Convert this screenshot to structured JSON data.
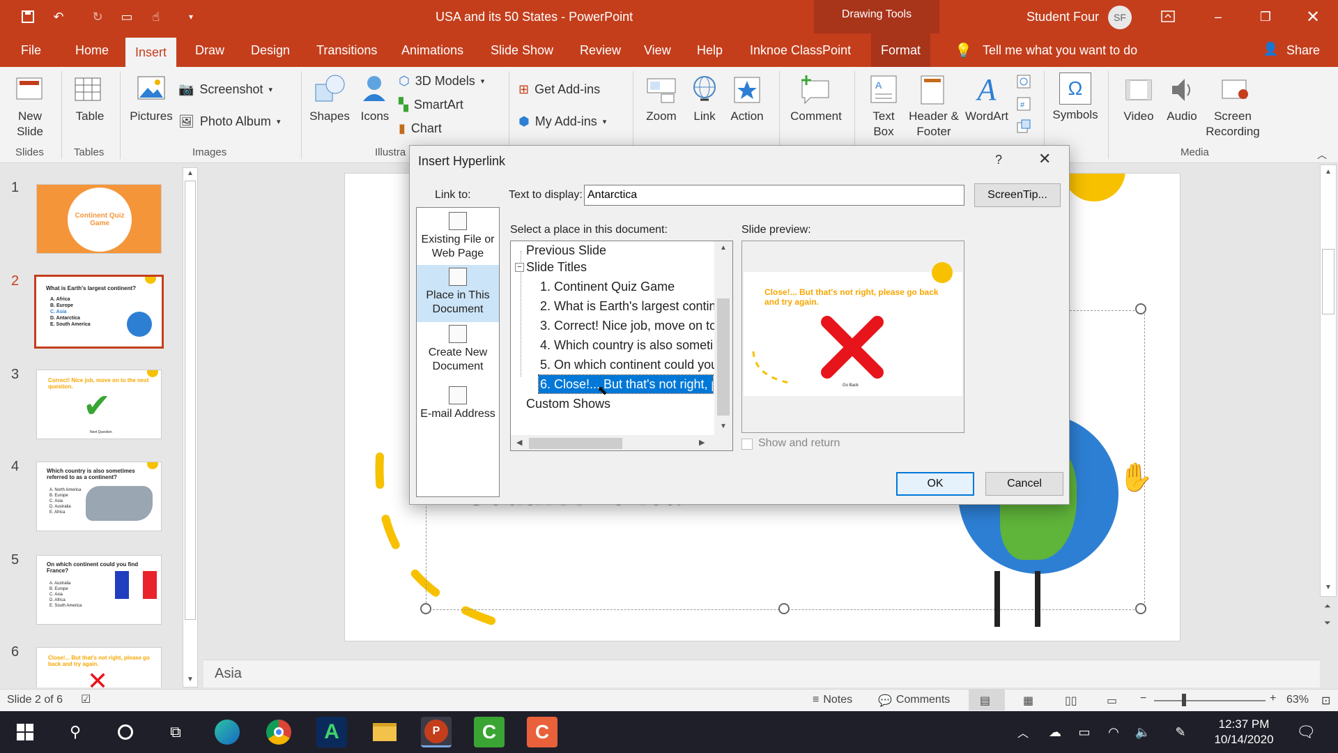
{
  "window": {
    "title": "USA and its 50 States  -  PowerPoint",
    "context_tab_label": "Drawing Tools",
    "user_name": "Student Four",
    "user_initials": "SF"
  },
  "tabs": [
    "File",
    "Home",
    "Insert",
    "Draw",
    "Design",
    "Transitions",
    "Animations",
    "Slide Show",
    "Review",
    "View",
    "Help",
    "Inknoe ClassPoint",
    "Format"
  ],
  "active_tab": "Insert",
  "tell_me": "Tell me what you want to do",
  "share": "Share",
  "ribbon": {
    "new_slide": "New Slide",
    "table": "Table",
    "pictures": "Pictures",
    "screenshot": "Screenshot",
    "photo_album": "Photo Album",
    "shapes": "Shapes",
    "icons": "Icons",
    "models_3d": "3D Models",
    "smartart": "SmartArt",
    "chart": "Chart",
    "get_addins": "Get Add-ins",
    "my_addins": "My Add-ins",
    "zoom": "Zoom",
    "link": "Link",
    "action": "Action",
    "comment": "Comment",
    "text_box": "Text Box",
    "header_footer": "Header & Footer",
    "wordart": "WordArt",
    "symbols": "Symbols",
    "video": "Video",
    "audio": "Audio",
    "screen_recording": "Screen Recording",
    "groups": {
      "slides": "Slides",
      "tables": "Tables",
      "images": "Images",
      "illustrations": "Illustra",
      "media": "Media"
    }
  },
  "thumbnails": [
    {
      "num": "1",
      "text": "Continent Quiz Game"
    },
    {
      "num": "2",
      "text": "What is Earth's largest continent?",
      "options": [
        "A. Africa",
        "B. Europe",
        "C. Asia",
        "D. Antarctica",
        "E. South America"
      ]
    },
    {
      "num": "3",
      "text": "Correct! Nice job, move on to the next question.",
      "sub": "Next Question"
    },
    {
      "num": "4",
      "text": "Which country is also sometimes referred to as a continent?",
      "options": [
        "A. North America",
        "B. Europe",
        "C. Asia",
        "D. Australia",
        "E. Africa"
      ]
    },
    {
      "num": "5",
      "text": "On which continent could you find France?",
      "options": [
        "A. Australia",
        "B. Europe",
        "C. Asia",
        "D. Africa",
        "E. South America"
      ]
    },
    {
      "num": "6",
      "text": "Close!... But that's not right, please go back and try again."
    }
  ],
  "slide": {
    "visible_text": "E. South America"
  },
  "notes_text": "Asia",
  "status": {
    "slide_info": "Slide 2 of 6",
    "notes": "Notes",
    "comments": "Comments",
    "zoom": "63%"
  },
  "taskbar": {
    "time": "12:37 PM",
    "date": "10/14/2020"
  },
  "dialog": {
    "title": "Insert Hyperlink",
    "help": "?",
    "link_to_label": "Link to:",
    "text_to_display_label": "Text to display:",
    "text_to_display_value": "Antarctica",
    "screentip": "ScreenTip...",
    "select_place_label": "Select a place in this document:",
    "slide_preview_label": "Slide preview:",
    "link_options": [
      "Existing File or Web Page",
      "Place in This Document",
      "Create New Document",
      "E-mail Address"
    ],
    "selected_link_option": "Place in This Document",
    "tree": {
      "previous_slide": "Previous Slide",
      "slide_titles": "Slide Titles",
      "items": [
        "1. Continent Quiz Game",
        "2. What is Earth's largest contin",
        "3. Correct! Nice job, move on to",
        "4. Which country is also someti",
        "5. On which continent could you",
        "6. Close!... But that's not right, p"
      ],
      "selected_index": 5,
      "custom_shows": "Custom Shows"
    },
    "preview": {
      "text": "Close!... But that's not right, please go back and try again.",
      "button": "Go Back"
    },
    "show_and_return": "Show and return",
    "ok": "OK",
    "cancel": "Cancel"
  },
  "colors": {
    "accent": "#c43e1c",
    "orange": "#f7a600",
    "select_blue": "#0078d7",
    "red_x": "#e8141c",
    "green_check": "#3aa533"
  }
}
